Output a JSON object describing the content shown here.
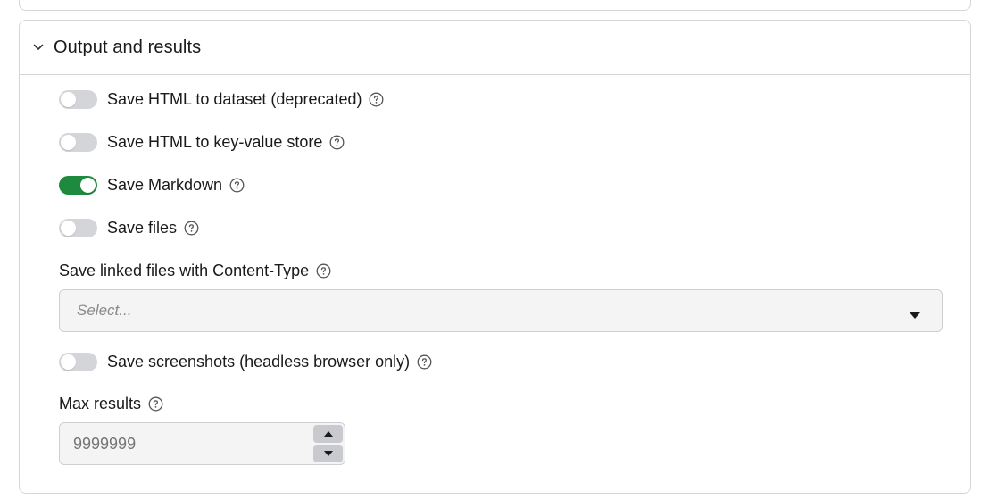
{
  "section": {
    "title": "Output and results",
    "expanded": true
  },
  "toggles": [
    {
      "label": "Save HTML to dataset (deprecated)",
      "checked": false
    },
    {
      "label": "Save HTML to key-value store",
      "checked": false
    },
    {
      "label": "Save Markdown",
      "checked": true
    },
    {
      "label": "Save files",
      "checked": false
    }
  ],
  "content_type": {
    "label": "Save linked files with Content-Type",
    "placeholder": "Select..."
  },
  "screenshots": {
    "label": "Save screenshots (headless browser only)",
    "checked": false
  },
  "max_results": {
    "label": "Max results",
    "placeholder": "9999999"
  },
  "colors": {
    "toggle_on": "#1e8a3e",
    "toggle_off": "#d4d5d8",
    "border": "#d6d6d6",
    "input_bg": "#f4f4f4"
  }
}
